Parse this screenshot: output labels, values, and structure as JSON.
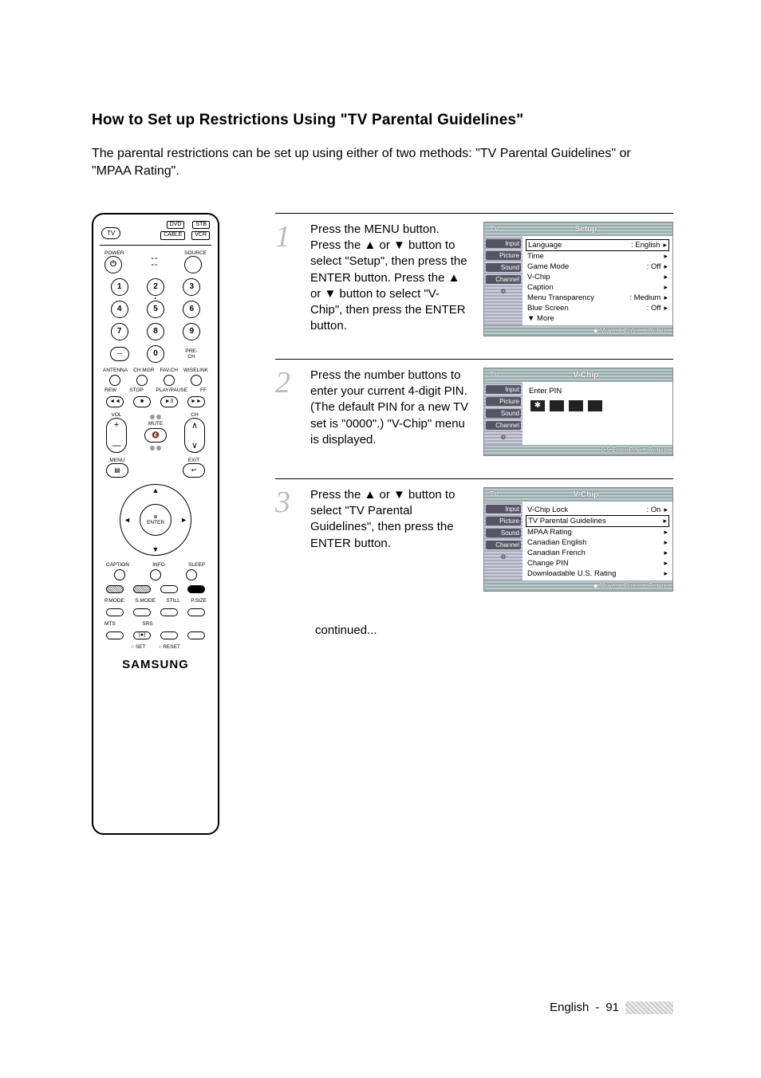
{
  "title": "How to Set up Restrictions Using \"TV Parental Guidelines\"",
  "intro": "The parental restrictions can be set up using either of two methods: \"TV Parental Guidelines\" or \"MPAA Rating\".",
  "remote": {
    "brand": "SAMSUNG",
    "top_buttons": {
      "tv": "TV",
      "dvd": "DVD",
      "stb": "STB",
      "cable": "CABLE",
      "vcr": "VCR"
    },
    "power": "POWER",
    "source": "SOURCE",
    "numbers": [
      "1",
      "2",
      "3",
      "4",
      "5",
      "6",
      "7",
      "8",
      "9",
      "0"
    ],
    "dash": "—",
    "prech": "PRE-CH",
    "labels_row": [
      "ANTENNA",
      "CH MGR",
      "FAV.CH",
      "WISELINK"
    ],
    "transport": [
      "REW",
      "STOP",
      "PLAY/PAUSE",
      "FF"
    ],
    "vol": "VOL",
    "ch": "CH",
    "mute": "MUTE",
    "menu": "MENU",
    "exit": "EXIT",
    "enter_top": "⊕",
    "enter": "ENTER",
    "caption": "CAPTION",
    "info": "INFO",
    "sleep": "SLEEP",
    "labels_row2": [
      "P.MODE",
      "S.MODE",
      "STILL",
      "P.SIZE"
    ],
    "labels_row3": [
      "MTS",
      "SRS",
      "",
      ""
    ],
    "set": "SET",
    "reset": "RESET"
  },
  "steps": [
    {
      "num": "1",
      "text": "Press the MENU button. Press the ▲ or ▼ button to select \"Setup\", then press the ENTER button. Press the ▲ or ▼ button to select \"V-Chip\", then press the ENTER button.",
      "osd": {
        "header_left": "TV",
        "header_title": "Setup",
        "side": [
          "Input",
          "Picture",
          "Sound",
          "Channel",
          ""
        ],
        "rows": [
          {
            "label": "Language",
            "value": ": English",
            "boxed": true
          },
          {
            "label": "Time",
            "value": ""
          },
          {
            "label": "Game Mode",
            "value": ": Off"
          },
          {
            "label": "V-Chip",
            "value": ""
          },
          {
            "label": "Caption",
            "value": ""
          },
          {
            "label": "Menu Transparency",
            "value": ": Medium"
          },
          {
            "label": "Blue Screen",
            "value": ": Off"
          },
          {
            "label": "▼ More",
            "value": "",
            "noarrow": true
          }
        ],
        "footer": "◆ Move   ⊕ Enter   ⟲ Return"
      }
    },
    {
      "num": "2",
      "text": "Press the number buttons to enter your current 4-digit PIN. (The default PIN for a new TV set is \"0000\".) \"V-Chip\" menu is displayed.",
      "osd": {
        "header_left": "TV",
        "header_title": "V-Chip",
        "side": [
          "Input",
          "Picture",
          "Sound",
          "Channel",
          ""
        ],
        "pin_label": "Enter PIN",
        "pin_filled": 1,
        "footer": "0-9 Enter PIN   ⟲ Return"
      }
    },
    {
      "num": "3",
      "text": "Press the ▲ or ▼ button to select \"TV Parental Guidelines\", then press the ENTER button.",
      "osd": {
        "header_left": "TV",
        "header_title": "V-Chip",
        "side": [
          "Input",
          "Picture",
          "Sound",
          "Channel",
          ""
        ],
        "rows": [
          {
            "label": "V-Chip Lock",
            "value": ": On"
          },
          {
            "label": "TV Parental Guidelines",
            "value": "",
            "boxed": true
          },
          {
            "label": "MPAA Rating",
            "value": ""
          },
          {
            "label": "Canadian English",
            "value": ""
          },
          {
            "label": "Canadian French",
            "value": ""
          },
          {
            "label": "Change PIN",
            "value": ""
          },
          {
            "label": "Downloadable U.S. Rating",
            "value": ""
          }
        ],
        "footer": "◆ Move   ⊕ Enter   ⟲ Return"
      }
    }
  ],
  "continued": "continued...",
  "footer": {
    "lang": "English",
    "sep": "-",
    "page": "91"
  }
}
